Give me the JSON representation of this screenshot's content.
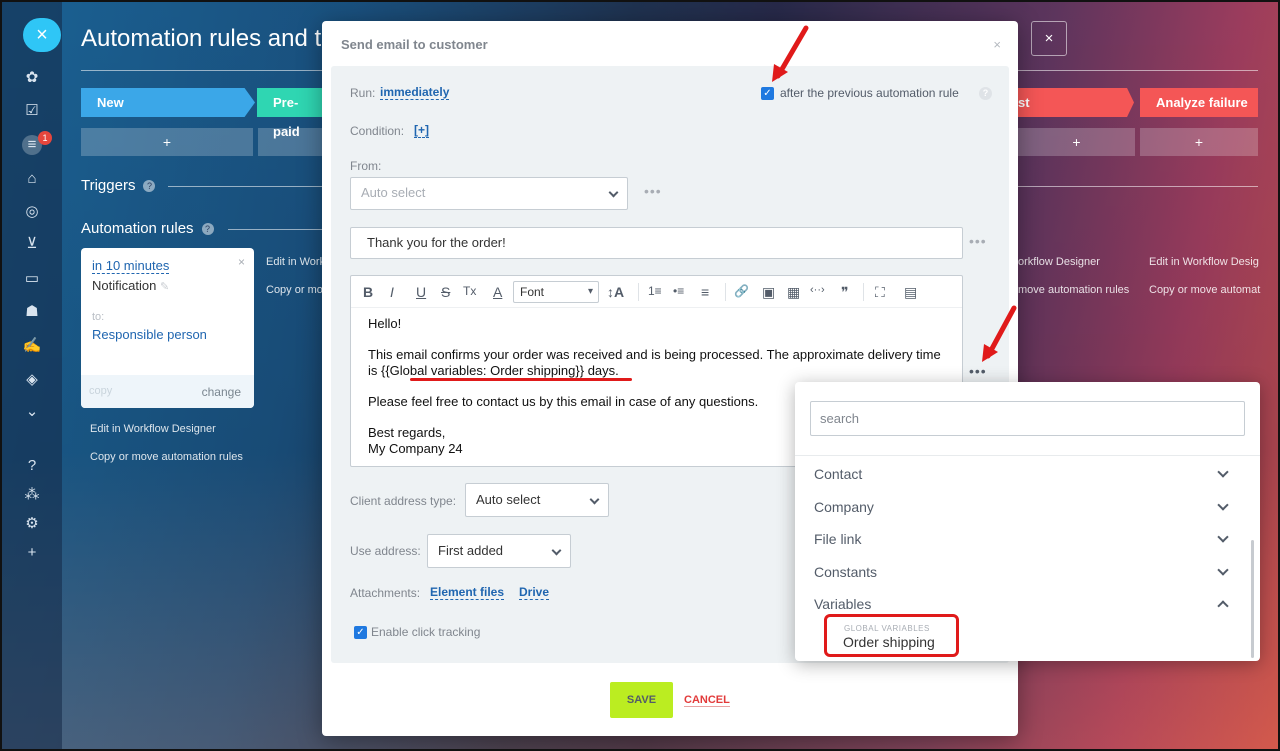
{
  "background": {
    "page_title": "Automation rules and tri",
    "stages": [
      {
        "label": "New",
        "color": "#3ba7e8"
      },
      {
        "label": "Pre-paid",
        "color": "#2fd6b2"
      },
      {
        "label": "st",
        "color": "#f45656"
      },
      {
        "label": "Analyze failure",
        "color": "#f45656"
      }
    ],
    "plus": "+",
    "triggers_label": "Triggers",
    "automation_rules_label": "Automation rules",
    "question": "?",
    "card": {
      "time": "in 10 minutes",
      "name": "Notification",
      "to_label": "to:",
      "recipient": "Responsible person",
      "copy": "copy",
      "change": "change",
      "close": "×"
    },
    "links": {
      "edit": "Edit in Workflow Designer",
      "copy_move": "Copy or move automation rules",
      "edit_partial": "Edit in Workf",
      "copy_partial": "Copy or mov",
      "edit_partial_right": "orkflow Designer",
      "copy_partial_right": "move automation rules",
      "edit_right": "Edit in Workflow Desig",
      "copy_right": "Copy or move automat"
    },
    "top_close": "×",
    "rail_badge": "1"
  },
  "modal": {
    "title": "Send email to customer",
    "close": "×",
    "run_label": "Run:",
    "run_value": "immediately",
    "after_previous": "after the previous automation rule",
    "condition_label": "Condition:",
    "condition_value": "[+]",
    "from_label": "From:",
    "from_placeholder": "Auto select",
    "subject": "Thank you for the order!",
    "more": "•••",
    "toolbar": {
      "bold": "B",
      "italic": "I",
      "underline": "U",
      "strike": "S",
      "clear": "Tx",
      "color": "A",
      "font": "Font",
      "size": "↕A",
      "ordered_list": "1≡",
      "bullet_list": "•≡",
      "align": "≡",
      "link": "🔗",
      "image": "▣",
      "table": "▦",
      "code": "‹··›",
      "quote": "❞",
      "fullscreen": "⛶",
      "video": "▤"
    },
    "body": {
      "greeting": "Hello!",
      "line1_a": "This email confirms your order was received and is being processed. The approximate delivery time is ",
      "line1_var": "{{Global variables: Order shipping}}",
      "line1_b": " days.",
      "line2": "Please feel free to contact us by this email in case of any questions.",
      "sign1": "Best regards,",
      "sign2": "My Company 24"
    },
    "client_address_label": "Client address type:",
    "client_address_value": "Auto select",
    "use_address_label": "Use address:",
    "use_address_value": "First added",
    "attachments_label": "Attachments:",
    "attach_element_files": "Element files",
    "attach_drive": "Drive",
    "click_tracking": "Enable click tracking",
    "save": "SAVE",
    "cancel": "CANCEL"
  },
  "popup": {
    "search_placeholder": "search",
    "items": [
      "Contact",
      "Company",
      "File link",
      "Constants",
      "Variables"
    ],
    "group_label": "GLOBAL VARIABLES",
    "selected_item": "Order shipping"
  },
  "colors": {
    "accent_blue": "#2066b0",
    "save_green": "#bbed21",
    "cancel_red": "#e23a3a",
    "annotation_red": "#e01a1a"
  }
}
